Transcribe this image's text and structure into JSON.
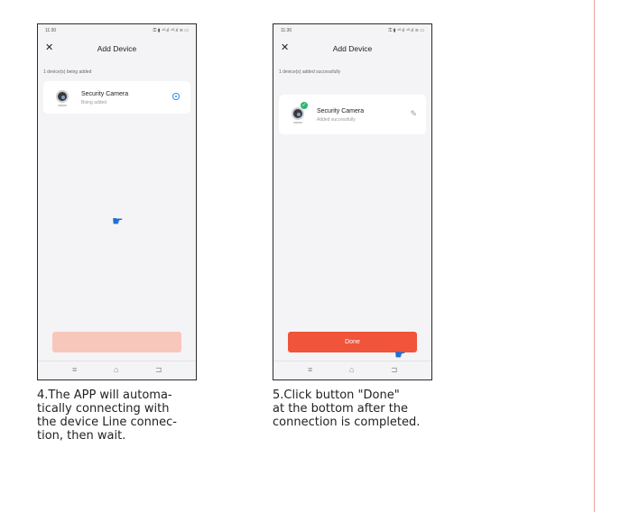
{
  "phone1": {
    "status": {
      "time": "11:30",
      "icons": "⚿ ▮ ⁴ᴳ.ıl ⁴ᴳ.ıl ≋ ▭"
    },
    "title": "Add Device",
    "subtitle": "1 device(s) being added",
    "device": {
      "name": "Security Camera",
      "status": "Boing added"
    },
    "button_label": "",
    "nav": {
      "menu": "≡",
      "home": "⌂",
      "back": "⊐"
    }
  },
  "phone2": {
    "status": {
      "time": "11:30",
      "icons": "⚿ ▮ ⁴ᴳ.ıl ⁴ᴳ.ıl ≋ ▭"
    },
    "title": "Add Device",
    "subtitle": "1 device(s) added successfully",
    "device": {
      "name": "Security Camera",
      "status": "Added successfully"
    },
    "button_label": "Done",
    "nav": {
      "menu": "≡",
      "home": "⌂",
      "back": "⊐"
    }
  },
  "captions": {
    "step4": [
      "4.The APP will automa-",
      "tically connecting with",
      "the device Line connec-",
      "tion, then wait."
    ],
    "step5": [
      "5.Click button \"Done\"",
      "at the bottom after the",
      "connection is completed."
    ]
  },
  "colors": {
    "accent": "#f0543a",
    "accent_disabled": "#f8c7bb",
    "success": "#2bb673",
    "pointer": "#1f6fd1",
    "divider": "#e8a39b"
  },
  "icons": {
    "close": "close-icon",
    "pointer": "hand-pointer-icon",
    "check": "check-icon",
    "edit": "pencil-icon",
    "spinner": "loading-icon"
  }
}
